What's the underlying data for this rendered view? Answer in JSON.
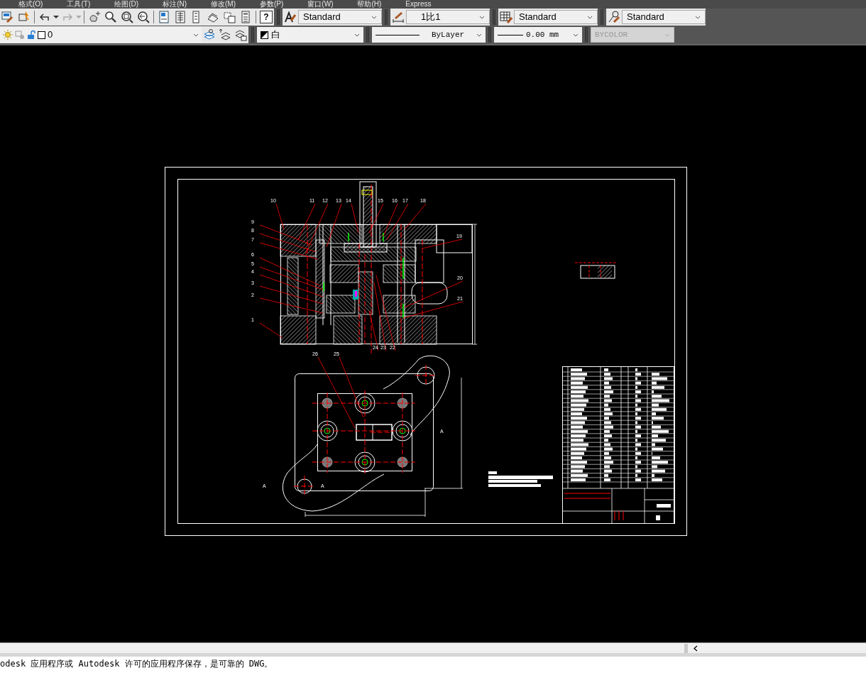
{
  "menu_bar": [
    "格式(O)",
    "工具(T)",
    "绘图(D)",
    "标注(N)",
    "修改(M)",
    "参数(P)",
    "窗口(W)",
    "帮助(H)",
    "Express"
  ],
  "toolbar_1": {
    "help_key": "?",
    "combos": [
      {
        "kind": "text-style",
        "value": "Standard"
      },
      {
        "kind": "dim-style",
        "value": "1比1"
      },
      {
        "kind": "table-style",
        "value": "Standard"
      },
      {
        "kind": "mleader-style",
        "value": "Standard"
      }
    ]
  },
  "toolbar_2": {
    "layer": {
      "name": "0",
      "on": true,
      "locked": false
    },
    "combos": [
      {
        "kind": "color",
        "value": "白",
        "disabled": false
      },
      {
        "kind": "linetype",
        "value": "ByLayer",
        "disabled": false
      },
      {
        "kind": "lineweight",
        "value": "0.00 mm",
        "disabled": false
      },
      {
        "kind": "plotstyle",
        "value": "BYCOLOR",
        "disabled": true
      }
    ]
  },
  "drawing": {
    "part_labels": [
      "9",
      "8",
      "7",
      "6",
      "5",
      "4",
      "3",
      "2",
      "1",
      "10",
      "11",
      "12",
      "13",
      "14",
      "15",
      "16",
      "17",
      "18",
      "19",
      "20",
      "21",
      "24",
      "23",
      "22",
      "26",
      "25"
    ],
    "section_marks": [
      "A",
      "A",
      "A"
    ]
  },
  "command_line": {
    "text": "odesk 应用程序或 Autodesk 许可的应用程序保存，是可靠的 DWG。"
  }
}
